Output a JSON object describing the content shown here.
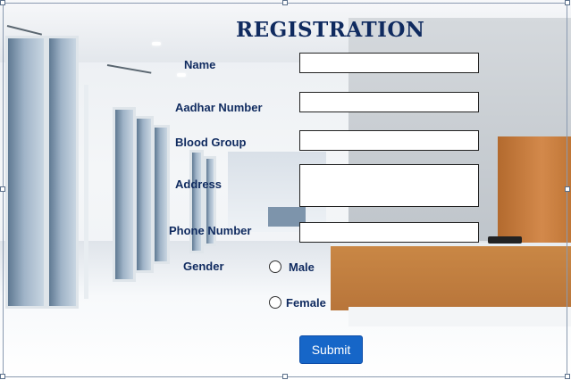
{
  "form": {
    "title": "REGISTRATION",
    "fields": {
      "name": {
        "label": "Name",
        "value": ""
      },
      "aadhar": {
        "label": "Aadhar Number",
        "value": ""
      },
      "blood_group": {
        "label": "Blood Group",
        "value": ""
      },
      "address": {
        "label": "Address",
        "value": ""
      },
      "phone": {
        "label": "Phone Number",
        "value": ""
      }
    },
    "gender": {
      "label": "Gender",
      "options": [
        "Male",
        "Female"
      ],
      "selected": null
    },
    "submit_label": "Submit"
  },
  "colors": {
    "text": "#0f2a5f",
    "button_bg": "#1666c8",
    "button_text": "#ffffff"
  }
}
